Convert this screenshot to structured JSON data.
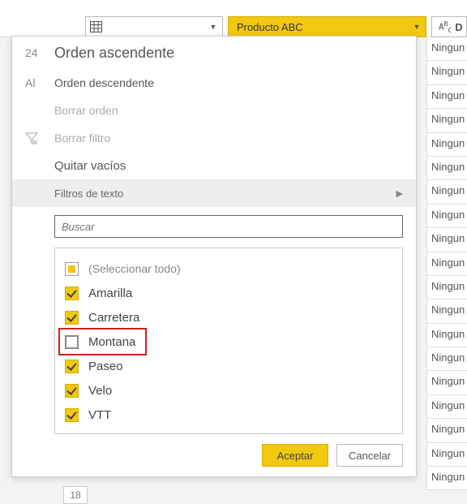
{
  "columns": {
    "c2_label": "Producto ABC",
    "c3_prefix": "A",
    "c3_prefix2": "B",
    "c3_prefix3": "C",
    "c3_label": "D"
  },
  "popup": {
    "sort_asc_prefix": "24",
    "sort_asc": "Orden ascendente",
    "sort_desc_prefix": "Al",
    "sort_desc": "Orden descendente",
    "clear_sort": "Borrar orden",
    "clear_filter": "Borrar filtro",
    "remove_empty": "Quitar vacíos",
    "text_filters": "Filtros de texto",
    "search_placeholder": "Buscar",
    "select_all": "(Seleccionar todo)",
    "items": [
      {
        "label": "Amarilla",
        "checked": true,
        "highlight": false
      },
      {
        "label": "Carretera",
        "checked": true,
        "highlight": false
      },
      {
        "label": "Montana",
        "checked": false,
        "highlight": true
      },
      {
        "label": "Paseo",
        "checked": true,
        "highlight": false
      },
      {
        "label": "Velo",
        "checked": true,
        "highlight": false
      },
      {
        "label": "VTT",
        "checked": true,
        "highlight": false
      }
    ],
    "accept": "Aceptar",
    "cancel": "Cancelar"
  },
  "data_cells": [
    "Ningun",
    "Ningun",
    "Ningun",
    "Ningun",
    "Ningun",
    "Ningun",
    "Ningun",
    "Ningun",
    "Ningun",
    "Ningun",
    "Ningun",
    "Ningun",
    "Ningun",
    "Ningun",
    "Ningun",
    "Ningun",
    "Ningun",
    "Ningun",
    "Ningun"
  ],
  "row_num": "18"
}
